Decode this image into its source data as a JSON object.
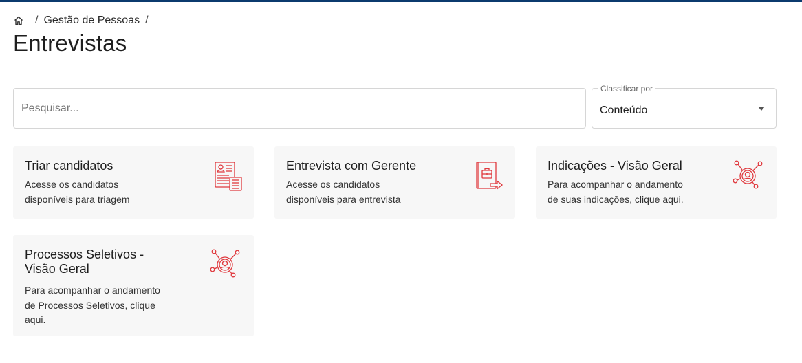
{
  "breadcrumb": {
    "home_icon": "home-icon",
    "items": [
      "Gestão de Pessoas"
    ],
    "separator": "/"
  },
  "page": {
    "title": "Entrevistas"
  },
  "search": {
    "placeholder": "Pesquisar...",
    "value": ""
  },
  "sort": {
    "label": "Classificar por",
    "value": "Conteúdo"
  },
  "colors": {
    "accent": "#e0393e",
    "topbar": "#0b3a6e",
    "card_bg": "#f7f7f7"
  },
  "cards": [
    {
      "title": "Triar candidatos",
      "description": "Acesse os candidatos disponíveis para triagem",
      "icon": "candidate-list-icon"
    },
    {
      "title": "Entrevista com Gerente",
      "description": "Acesse os candidatos disponíveis para entrevista",
      "icon": "interview-briefcase-icon"
    },
    {
      "title": "Indicações - Visão Geral",
      "description": "Para acompanhar o andamento de suas indicações, clique aqui.",
      "icon": "network-person-icon"
    },
    {
      "title": "Processos Seletivos - Visão Geral",
      "description": "Para acompanhar o andamento de Processos Seletivos, clique aqui.",
      "icon": "network-person-icon"
    }
  ]
}
